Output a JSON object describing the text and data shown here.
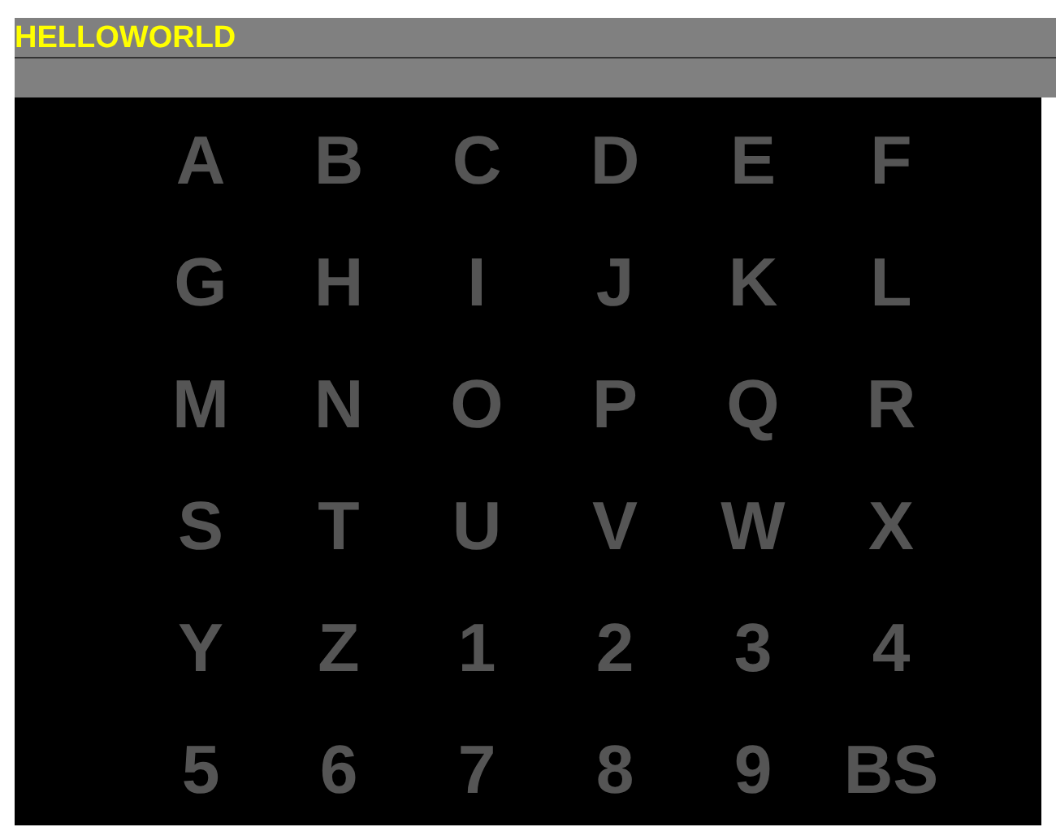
{
  "title": "HELLOWORLD",
  "keys": [
    "A",
    "B",
    "C",
    "D",
    "E",
    "F",
    "G",
    "H",
    "I",
    "J",
    "K",
    "L",
    "M",
    "N",
    "O",
    "P",
    "Q",
    "R",
    "S",
    "T",
    "U",
    "V",
    "W",
    "X",
    "Y",
    "Z",
    "1",
    "2",
    "3",
    "4",
    "5",
    "6",
    "7",
    "8",
    "9",
    "BS"
  ]
}
